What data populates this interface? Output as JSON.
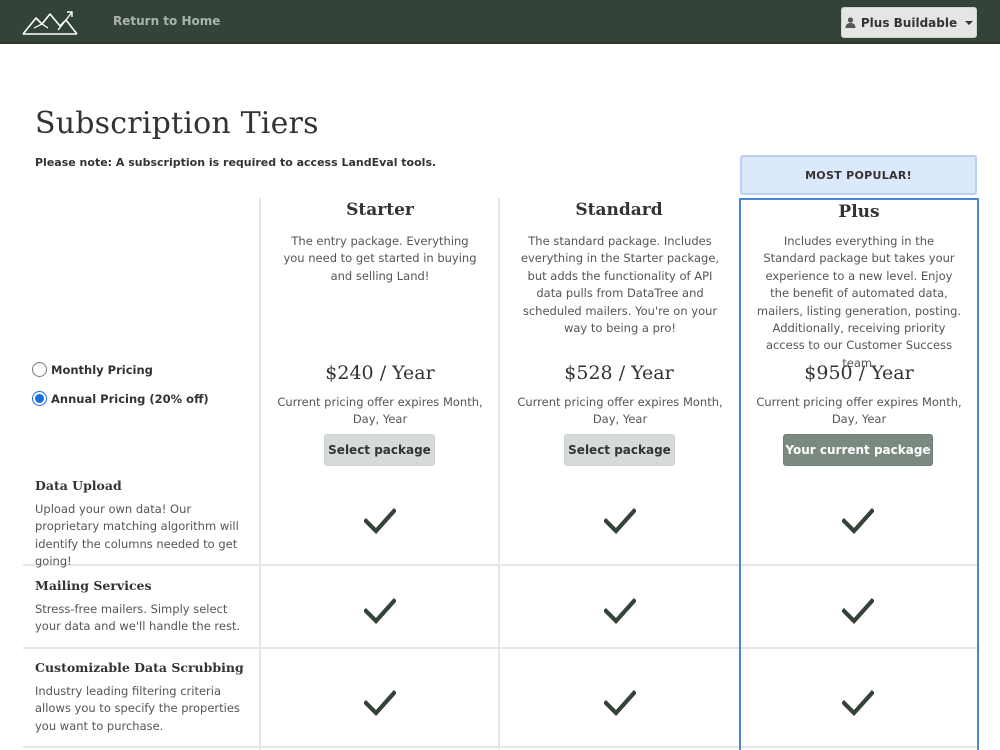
{
  "nav": {
    "home_link": "Return to Home",
    "user_menu": "Plus Buildable"
  },
  "page": {
    "title": "Subscription Tiers",
    "note": "Please note: A subscription is required to access LandEval tools.",
    "popular_badge": "MOST POPULAR!"
  },
  "pricing": {
    "monthly_label": "Monthly Pricing",
    "annual_label": "Annual Pricing (20% off)",
    "selected": "annual"
  },
  "tiers": [
    {
      "name": "Starter",
      "description": "The entry package. Everything you need to get started in buying and selling Land!",
      "price": "$240 / Year",
      "expires": "Current pricing offer expires Month, Day, Year",
      "button": "Select package"
    },
    {
      "name": "Standard",
      "description": "The standard package. Includes everything in the Starter package, but adds the functionality of API data pulls from DataTree and scheduled mailers. You're on your way to being a pro!",
      "price": "$528 / Year",
      "expires": "Current pricing offer expires Month, Day, Year",
      "button": "Select package"
    },
    {
      "name": "Plus",
      "description": "Includes everything in the Standard package but takes your experience to a new level. Enjoy the benefit of automated data, mailers, listing generation, posting. Additionally, receiving priority access to our Customer Success team.",
      "price": "$950 / Year",
      "expires": "Current pricing offer expires Month, Day, Year",
      "button": "Your current package"
    }
  ],
  "features": [
    {
      "title": "Data Upload",
      "description": "Upload your own data! Our proprietary matching algorithm will identify the columns needed to get going!"
    },
    {
      "title": "Mailing Services",
      "description": "Stress-free mailers. Simply select your data and we'll handle the rest."
    },
    {
      "title": "Customizable Data Scrubbing",
      "description": "Industry leading filtering criteria allows you to specify the properties you want to purchase."
    }
  ],
  "colors": {
    "navbar": "#344338",
    "accent_blue": "#4a86d8",
    "check": "#344338",
    "popular_bg": "#dce8fc"
  }
}
